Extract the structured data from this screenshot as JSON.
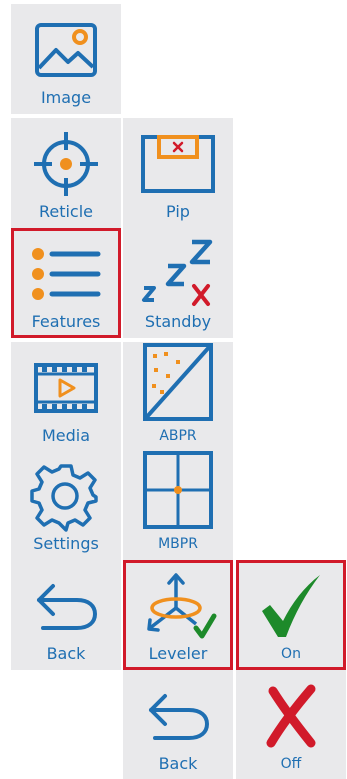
{
  "colors": {
    "tile_bg": "#e9e9eb",
    "icon_blue": "#1f6fb2",
    "accent_orange": "#f0901e",
    "selected_border": "#d11a2a",
    "check_green": "#1d8a2a",
    "cross_red": "#d11a2a"
  },
  "menu": {
    "column1": [
      {
        "label": "Image",
        "icon": "image-icon"
      },
      {
        "label": "Reticle",
        "icon": "crosshair-icon"
      },
      {
        "label": "Features",
        "icon": "list-icon",
        "selected": true
      },
      {
        "label": "Media",
        "icon": "film-play-icon"
      },
      {
        "label": "Settings",
        "icon": "gear-icon"
      },
      {
        "label": "Back",
        "icon": "back-arrow-icon"
      }
    ],
    "column2": [
      {
        "label": "Pip",
        "icon": "picture-in-picture-icon"
      },
      {
        "label": "Standby",
        "icon": "sleep-icon"
      },
      {
        "label": "ABPR",
        "icon": "abpr-icon"
      },
      {
        "label": "MBPR",
        "icon": "mbpr-icon"
      },
      {
        "label": "Leveler",
        "icon": "leveler-icon",
        "selected": true
      },
      {
        "label": "Back",
        "icon": "back-arrow-icon"
      }
    ],
    "column3": [
      {
        "label": "On",
        "icon": "checkmark-icon",
        "selected": true
      },
      {
        "label": "Off",
        "icon": "cross-icon"
      }
    ]
  }
}
